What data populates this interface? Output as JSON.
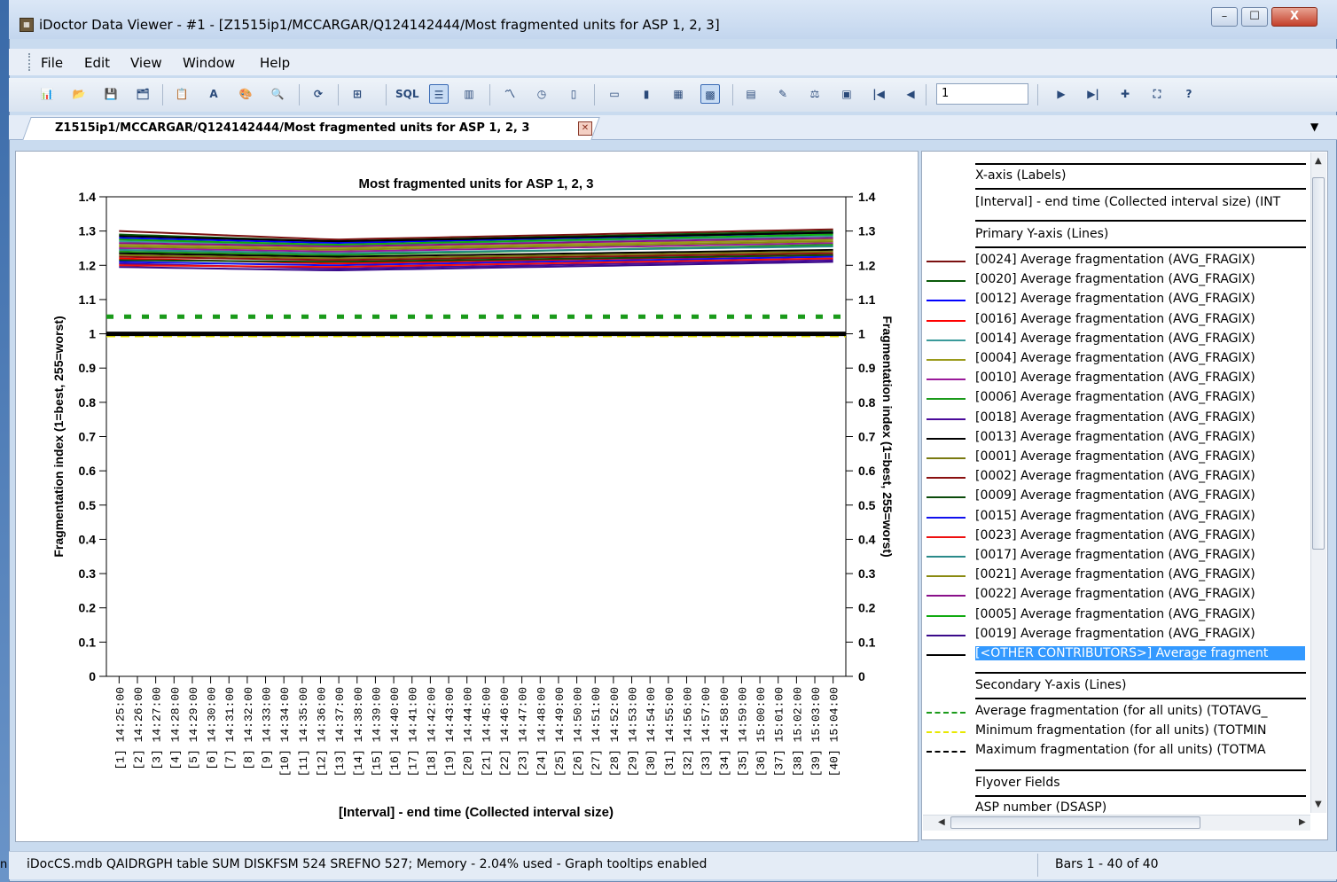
{
  "window": {
    "title": "iDoctor Data Viewer - #1 - [Z1515ip1/MCCARGAR/Q124142444/Most fragmented units for ASP 1, 2, 3]",
    "controls": [
      "–",
      "☐",
      "X"
    ]
  },
  "desktop_fragment": "n",
  "menu": [
    "File",
    "Edit",
    "View",
    "Window",
    "Help"
  ],
  "toolbar": {
    "page_value": "1",
    "icons": [
      "sql-chart-icon",
      "open-icon",
      "save-icon",
      "properties-icon",
      "copy-icon",
      "font-icon",
      "color-icon",
      "zoom-icon",
      "refresh-icon",
      "layout-icon",
      "sql-icon",
      "legend-toggle-icon",
      "chart-type-icon",
      "line-chart-icon",
      "clock-icon",
      "panel-icon",
      "bars-icon",
      "columns-icon",
      "grid-icon",
      "chart-options-icon",
      "table-icon",
      "paint-icon",
      "scale-icon",
      "image-icon",
      "first-page-icon",
      "prev-page-icon",
      "next-page-icon",
      "last-page-icon",
      "add-icon",
      "fullscreen-icon",
      "help-icon"
    ]
  },
  "tab": {
    "label": "Z1515ip1/MCCARGAR/Q124142444/Most fragmented units for ASP 1, 2, 3"
  },
  "chart_data": {
    "type": "line",
    "title": "Most fragmented units for ASP 1, 2, 3",
    "xlabel": "[Interval] - end time (Collected interval size)",
    "ylabel": "Fragmentation index (1=best, 255=worst)",
    "y2label": "Fragmentation index (1=best, 255=worst)",
    "ylim": [
      0,
      1.4
    ],
    "yticks": [
      "0",
      "0.1",
      "0.2",
      "0.3",
      "0.4",
      "0.5",
      "0.6",
      "0.7",
      "0.8",
      "0.9",
      "1",
      "1.1",
      "1.2",
      "1.3",
      "1.4"
    ],
    "categories": [
      "[1] 14:25:00",
      "[2] 14:26:00",
      "[3] 14:27:00",
      "[4] 14:28:00",
      "[5] 14:29:00",
      "[6] 14:30:00",
      "[7] 14:31:00",
      "[8] 14:32:00",
      "[9] 14:33:00",
      "[10] 14:34:00",
      "[11] 14:35:00",
      "[12] 14:36:00",
      "[13] 14:37:00",
      "[14] 14:38:00",
      "[15] 14:39:00",
      "[16] 14:40:00",
      "[17] 14:41:00",
      "[18] 14:42:00",
      "[19] 14:43:00",
      "[20] 14:44:00",
      "[21] 14:45:00",
      "[22] 14:46:00",
      "[23] 14:47:00",
      "[24] 14:48:00",
      "[25] 14:49:00",
      "[26] 14:50:00",
      "[27] 14:51:00",
      "[28] 14:52:00",
      "[29] 14:53:00",
      "[30] 14:54:00",
      "[31] 14:55:00",
      "[32] 14:56:00",
      "[33] 14:57:00",
      "[34] 14:58:00",
      "[35] 14:59:00",
      "[36] 15:00:00",
      "[37] 15:01:00",
      "[38] 15:02:00",
      "[39] 15:03:00",
      "[40] 15:04:00"
    ],
    "series": [
      {
        "name": "[0024] Average fragmentation (AVG_FRAGIX)",
        "color": "#7b1010",
        "start": 1.3,
        "mid": 1.275,
        "end": 1.305
      },
      {
        "name": "[0020] Average fragmentation (AVG_FRAGIX)",
        "color": "#0a5a0a",
        "start": 1.29,
        "mid": 1.27,
        "end": 1.3
      },
      {
        "name": "[0012] Average fragmentation (AVG_FRAGIX)",
        "color": "#0000ff",
        "start": 1.28,
        "mid": 1.265,
        "end": 1.295
      },
      {
        "name": "[0016] Average fragmentation (AVG_FRAGIX)",
        "color": "#ff0000",
        "start": 1.22,
        "mid": 1.205,
        "end": 1.23
      },
      {
        "name": "[0014] Average fragmentation (AVG_FRAGIX)",
        "color": "#3a9a9a",
        "start": 1.27,
        "mid": 1.26,
        "end": 1.285
      },
      {
        "name": "[0004] Average fragmentation (AVG_FRAGIX)",
        "color": "#9a9a1a",
        "start": 1.26,
        "mid": 1.25,
        "end": 1.275
      },
      {
        "name": "[0010] Average fragmentation (AVG_FRAGIX)",
        "color": "#9a1a9a",
        "start": 1.25,
        "mid": 1.24,
        "end": 1.265
      },
      {
        "name": "[0006] Average fragmentation (AVG_FRAGIX)",
        "color": "#1a9a1a",
        "start": 1.24,
        "mid": 1.23,
        "end": 1.26
      },
      {
        "name": "[0018] Average fragmentation (AVG_FRAGIX)",
        "color": "#4a0a9a",
        "start": 1.205,
        "mid": 1.19,
        "end": 1.215
      },
      {
        "name": "[0013] Average fragmentation (AVG_FRAGIX)",
        "color": "#000000",
        "start": 1.235,
        "mid": 1.225,
        "end": 1.245
      },
      {
        "name": "[0001] Average fragmentation (AVG_FRAGIX)",
        "color": "#7a7a10",
        "start": 1.23,
        "mid": 1.22,
        "end": 1.24
      },
      {
        "name": "[0002] Average fragmentation (AVG_FRAGIX)",
        "color": "#8a1010",
        "start": 1.225,
        "mid": 1.215,
        "end": 1.235
      },
      {
        "name": "[0009] Average fragmentation (AVG_FRAGIX)",
        "color": "#0a4a0a",
        "start": 1.215,
        "mid": 1.21,
        "end": 1.23
      },
      {
        "name": "[0015] Average fragmentation (AVG_FRAGIX)",
        "color": "#1010ee",
        "start": 1.21,
        "mid": 1.2,
        "end": 1.225
      },
      {
        "name": "[0023] Average fragmentation (AVG_FRAGIX)",
        "color": "#ee1010",
        "start": 1.2,
        "mid": 1.195,
        "end": 1.22
      },
      {
        "name": "[0017] Average fragmentation (AVG_FRAGIX)",
        "color": "#2a8a8a",
        "start": 1.245,
        "mid": 1.235,
        "end": 1.255
      },
      {
        "name": "[0021] Average fragmentation (AVG_FRAGIX)",
        "color": "#8a8a10",
        "start": 1.255,
        "mid": 1.245,
        "end": 1.27
      },
      {
        "name": "[0022] Average fragmentation (AVG_FRAGIX)",
        "color": "#8a108a",
        "start": 1.265,
        "mid": 1.255,
        "end": 1.28
      },
      {
        "name": "[0005] Average fragmentation (AVG_FRAGIX)",
        "color": "#10aa10",
        "start": 1.275,
        "mid": 1.26,
        "end": 1.29
      },
      {
        "name": "[0019] Average fragmentation (AVG_FRAGIX)",
        "color": "#3a0a8a",
        "start": 1.195,
        "mid": 1.185,
        "end": 1.21
      },
      {
        "name": "[<OTHER CONTRIBUTORS>] Average fragmentation",
        "color": "#000000",
        "start": 1.285,
        "mid": 1.27,
        "end": 1.295
      }
    ],
    "secondary": [
      {
        "name": "Average fragmentation (for all units) (TOTAVG_",
        "color": "#1a9a1a",
        "value": 1.05
      },
      {
        "name": "Minimum fragmentation (for all units) (TOTMIN",
        "color": "#e8e800",
        "value": 0.995
      },
      {
        "name": "Maximum fragmentation (for all units) (TOTMA",
        "color": "#000000",
        "value": 1.0
      }
    ]
  },
  "legend": {
    "xaxis_heading": "X-axis (Labels)",
    "xaxis_item": "[Interval] - end time (Collected interval size) (INT",
    "primary_heading": "Primary Y-axis (Lines)",
    "secondary_heading": "Secondary Y-axis (Lines)",
    "flyover_heading": "Flyover Fields",
    "flyover_item": "ASP number (DSASP)",
    "selected_item": "[<OTHER CONTRIBUTORS>] Average fragment"
  },
  "status": {
    "left": "iDocCS.mdb QAIDRGPH table SUM DISKFSM 524 SREFNO 527; Memory - 2.04% used - Graph tooltips enabled",
    "right": "Bars 1 - 40 of 40"
  }
}
